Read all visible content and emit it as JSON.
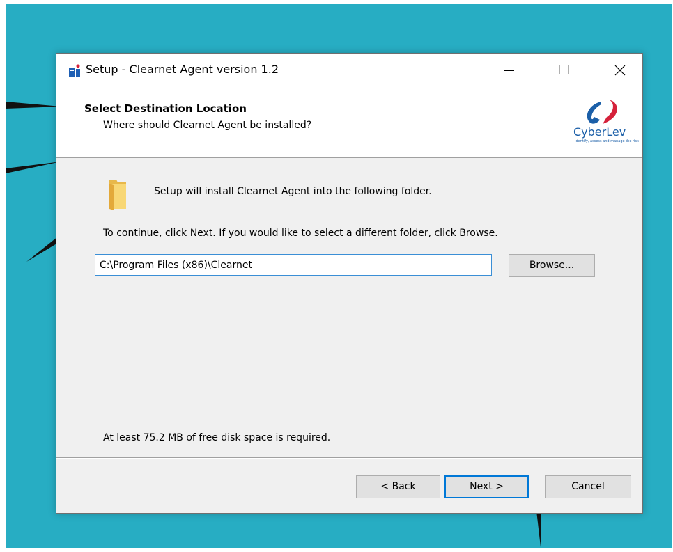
{
  "window": {
    "title": "Setup - Clearnet Agent version 1.2"
  },
  "header": {
    "title": "Select Destination Location",
    "subtitle": "Where should Clearnet Agent be installed?",
    "logo_name": "CyberLev",
    "logo_tagline": "Identify, assess and manage the risk"
  },
  "body": {
    "intro": "Setup will install Clearnet Agent into the following folder.",
    "instruction": "To continue, click Next. If you would like to select a different folder, click Browse.",
    "path_value": "C:\\Program Files (x86)\\Clearnet",
    "browse_label": "Browse...",
    "space_note": "At least 75.2 MB of free disk space is required."
  },
  "footer": {
    "back_label": "< Back",
    "next_label": "Next >",
    "cancel_label": "Cancel"
  },
  "icons": {
    "app": "setup-icon",
    "folder": "folder-icon",
    "minimize": "minimize-icon",
    "maximize": "maximize-icon",
    "close": "close-icon"
  },
  "colors": {
    "desktop": "#27adc3",
    "accent": "#0078d7",
    "logo_blue": "#1b5fa8",
    "logo_red": "#d5213a"
  }
}
